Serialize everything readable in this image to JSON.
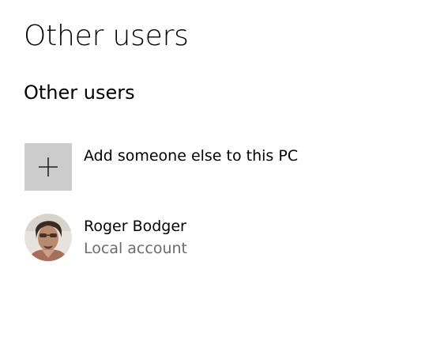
{
  "page": {
    "title": "Other users"
  },
  "section": {
    "title": "Other users"
  },
  "add_user": {
    "label": "Add someone else to this PC",
    "icon": "plus-icon"
  },
  "users": [
    {
      "name": "Roger Bodger",
      "account_type": "Local account",
      "avatar": "user-avatar-photo"
    }
  ],
  "colors": {
    "tile_background": "#cccccc",
    "secondary_text": "#6b6b6b"
  }
}
